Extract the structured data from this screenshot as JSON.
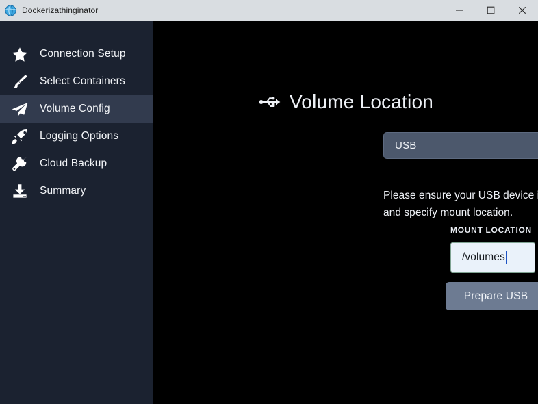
{
  "window": {
    "title": "Dockerizathinginator",
    "icon": "globe-icon",
    "controls": {
      "minimize": "minimize-icon",
      "maximize": "maximize-icon",
      "close": "close-icon"
    }
  },
  "sidebar": {
    "items": [
      {
        "label": "Connection Setup",
        "icon": "star-icon",
        "active": false
      },
      {
        "label": "Select Containers",
        "icon": "paint-brush-icon",
        "active": false
      },
      {
        "label": "Volume Config",
        "icon": "paper-plane-icon",
        "active": true
      },
      {
        "label": "Logging Options",
        "icon": "rocket-icon",
        "active": false
      },
      {
        "label": "Cloud Backup",
        "icon": "wrench-icon",
        "active": false
      },
      {
        "label": "Summary",
        "icon": "download-tray-icon",
        "active": false
      }
    ]
  },
  "main": {
    "heading": {
      "icon": "usb-icon",
      "text": "Volume Location"
    },
    "volume_type": {
      "selected": "USB",
      "options": [
        "USB"
      ],
      "chevron": "chevron-down-icon"
    },
    "instruction": "Please ensure your USB device is connecte to Pi and specify mount location.",
    "mount_location": {
      "label": "MOUNT LOCATION",
      "value": "/volumes",
      "placeholder": ""
    },
    "prepare_button": "Prepare USB"
  },
  "colors": {
    "titlebar_bg": "#d9dde1",
    "sidebar_bg": "#1b2230",
    "sidebar_active_bg": "#323b4e",
    "content_bg": "#000000",
    "select_bg": "#4c586c",
    "button_bg": "#6d7b92",
    "input_bg": "#eaf2fa",
    "caret": "#1d53c4"
  }
}
